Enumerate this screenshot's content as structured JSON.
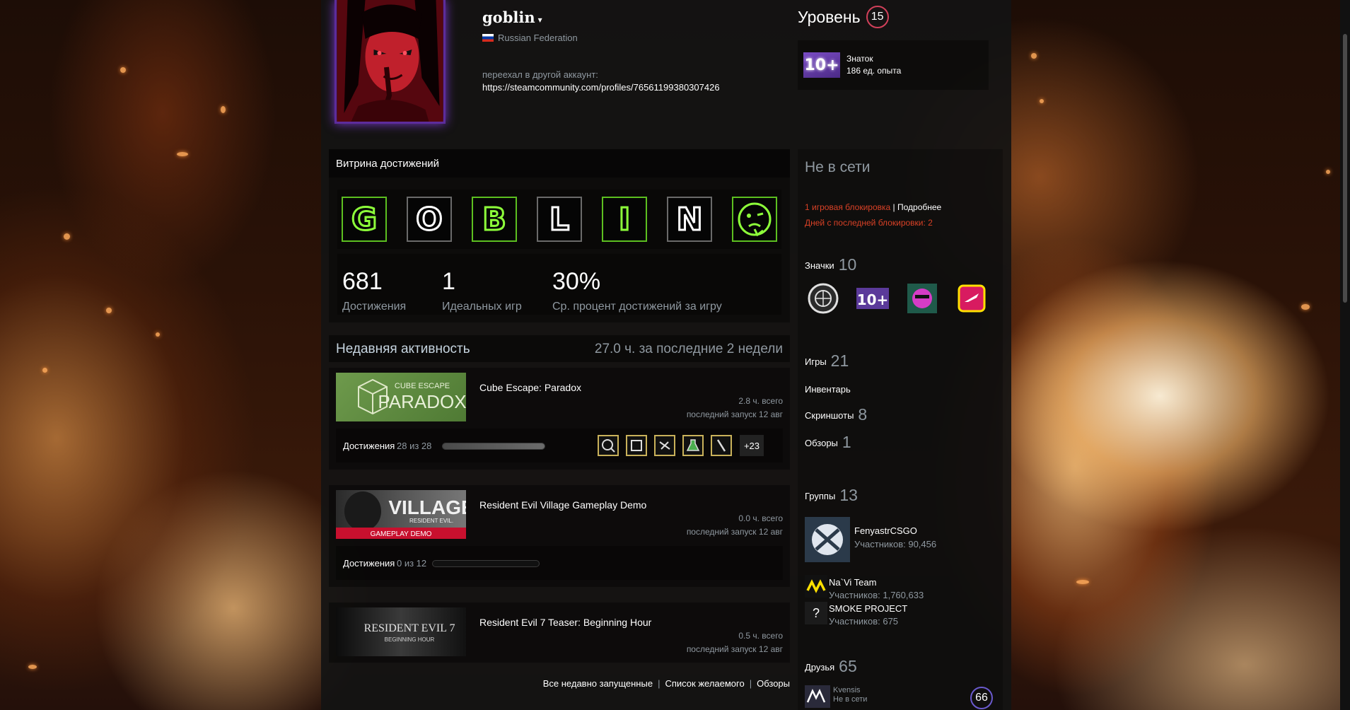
{
  "profile": {
    "persona_name": "goblin",
    "caret": "▾",
    "country": "Russian Federation",
    "summary_line1": "переехал в другой аккаунт:",
    "summary_line2": "https://steamcommunity.com/profiles/76561199380307426"
  },
  "level": {
    "label": "Уровень",
    "value": "15"
  },
  "favorite_badge": {
    "icon_text": "10+",
    "name": "Знаток",
    "xp": "186 ед. опыта"
  },
  "showcase": {
    "title": "Витрина достижений",
    "letters": [
      "G",
      "O",
      "B",
      "L",
      "I",
      "N",
      "face"
    ],
    "stats": [
      {
        "value": "681",
        "label": "Достижения"
      },
      {
        "value": "1",
        "label": "Идеальных игр"
      },
      {
        "value": "30%",
        "label": "Ср. процент достижений за игру"
      }
    ]
  },
  "recent": {
    "title": "Недавняя активность",
    "hours": "27.0 ч. за последние 2 недели",
    "games": [
      {
        "name": "Cube Escape: Paradox",
        "capsule_text": [
          "CUBE ESCAPE",
          "PARADOX"
        ],
        "hours": "2.8 ч. всего",
        "last": "последний запуск 12 авг",
        "ach_label": "Достижения",
        "ach_count": "28 из 28",
        "ach_progress": 1.0,
        "more": "+23"
      },
      {
        "name": "Resident Evil Village Gameplay Demo",
        "capsule_text": [
          "VILLAGE",
          "RESIDENT EVIL.",
          "GAMEPLAY DEMO"
        ],
        "hours": "0.0 ч. всего",
        "last": "последний запуск 12 авг",
        "ach_label": "Достижения",
        "ach_count": "0 из 12",
        "ach_progress": 0.0
      },
      {
        "name": "Resident Evil 7 Teaser: Beginning Hour",
        "capsule_text": [
          "RESIDENT EVIL 7",
          "BEGINNING HOUR"
        ],
        "hours": "0.5 ч. всего",
        "last": "последний запуск 12 авг"
      }
    ],
    "links": [
      "Все недавно запущенные",
      "Список желаемого",
      "Обзоры"
    ]
  },
  "sidebar": {
    "status": "Не в сети",
    "ban_count": "1 игровая блокировка",
    "ban_sep": " | ",
    "ban_more": "Подробнее",
    "ban_days": "Дней с последней блокировки: 2",
    "badges": {
      "label": "Значки",
      "count": "10"
    },
    "games": {
      "label": "Игры",
      "count": "21"
    },
    "inventory": {
      "label": "Инвентарь"
    },
    "screenshots": {
      "label": "Скриншоты",
      "count": "8"
    },
    "reviews": {
      "label": "Обзоры",
      "count": "1"
    },
    "groups": {
      "label": "Группы",
      "count": "13",
      "items": [
        {
          "name": "FenyastrCSGO",
          "members": "Участников: 90,456"
        },
        {
          "name": "Na`Vi Team",
          "members": "Участников: 1,760,633"
        },
        {
          "name": "SMOKE PROJECT",
          "members": "Участников: 675",
          "icon_text": "?"
        }
      ]
    },
    "friends": {
      "label": "Друзья",
      "count": "65",
      "items": [
        {
          "name": "Kvensis",
          "status": "Не в сети",
          "level": "66"
        }
      ]
    }
  },
  "colors": {
    "green": "#5cbf20",
    "ban_red": "#d94126",
    "level_ring": "#d1405a"
  }
}
